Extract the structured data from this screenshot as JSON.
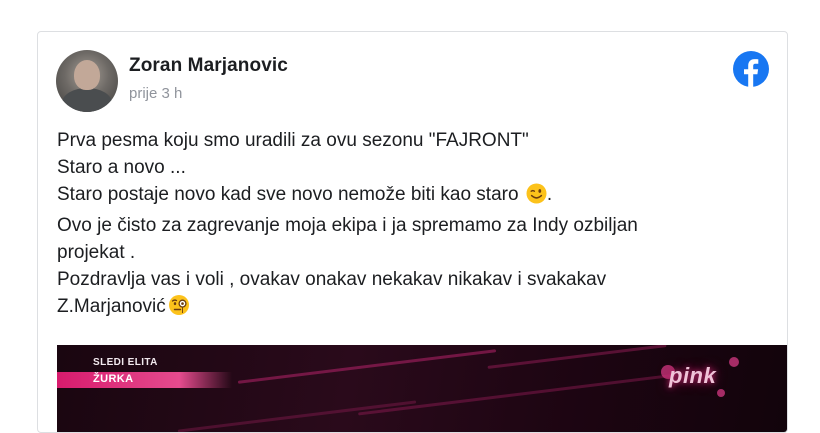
{
  "post": {
    "author": "Zoran Marjanovic",
    "timestamp": "prije 3 h",
    "brand_icon": "facebook-icon",
    "brand_color": "#1877f2",
    "lines": [
      "Prva pesma koju smo uradili za ovu sezonu \"FAJRONT\"",
      "Staro a novo ...",
      "Staro postaje novo kad sve novo nemože biti kao staro",
      "Ovo je čisto za zagrevanje moja ekipa i ja spremamo za Indy ozbiljan",
      "projekat .",
      "Pozdravlja vas i voli , ovakav onakav nekakav nikakav i svakakav",
      "Z.Marjanović"
    ],
    "line3_emoji": "winking-face-emoji",
    "line3_suffix": ".",
    "line7_emoji": "face-with-monocle-emoji"
  },
  "media": {
    "next_label": "SLEDI ELITA",
    "show_label": "ŽURKA",
    "channel_logo": "pink",
    "accent_color": "#d81b6d"
  }
}
